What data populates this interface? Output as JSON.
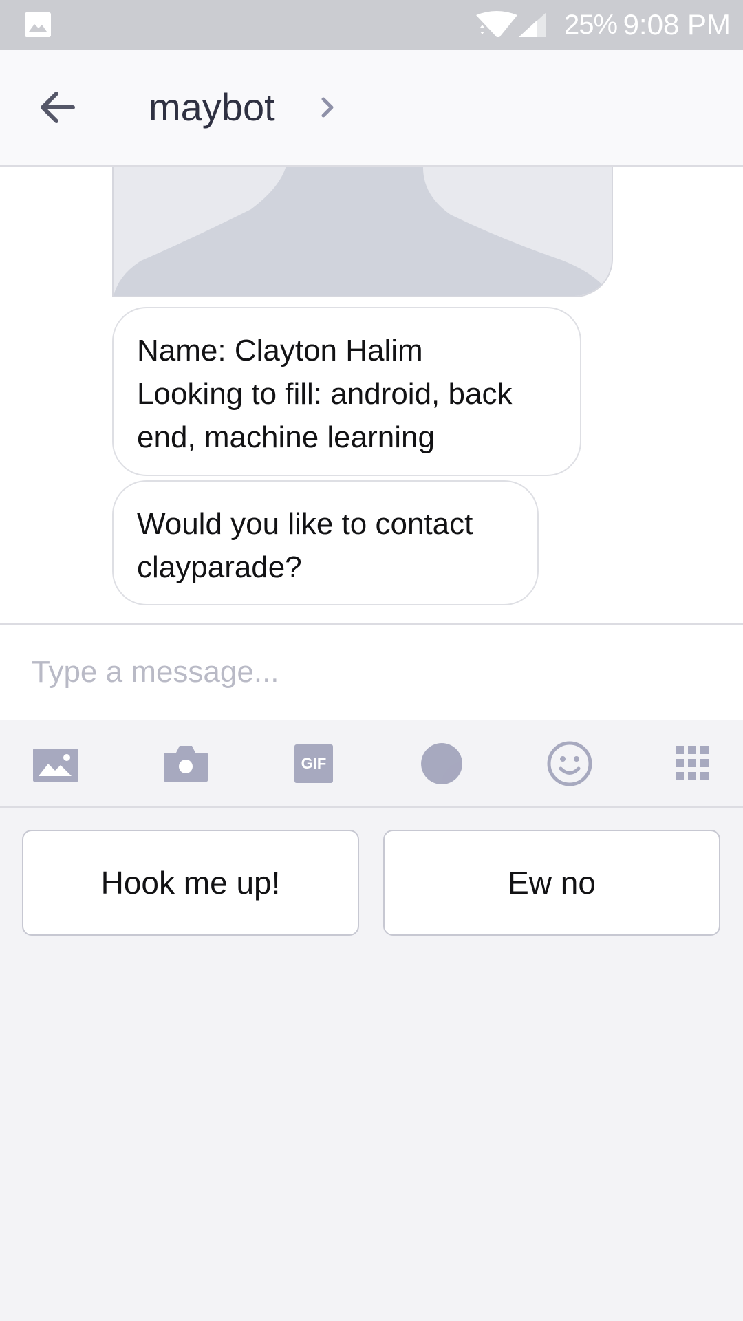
{
  "status_bar": {
    "battery": "25%",
    "time": "9:08 PM"
  },
  "header": {
    "title": "maybot"
  },
  "messages": {
    "profile": {
      "lines": [
        "Name: Clayton Halim",
        "Looking to fill: android, back",
        "end, machine learning"
      ]
    },
    "question": {
      "lines": [
        "Would you like to contact",
        "clayparade?"
      ]
    }
  },
  "composer": {
    "placeholder": "Type a message...",
    "value": ""
  },
  "toolbar": {
    "gif_label": "GIF",
    "icons": [
      "photo-icon",
      "camera-icon",
      "gif-icon",
      "sticker-icon",
      "emoji-icon",
      "apps-grid-icon"
    ]
  },
  "quick_replies": [
    {
      "label": "Hook me up!"
    },
    {
      "label": "Ew no"
    }
  ],
  "colors": {
    "status_bar": "#cbccd1",
    "icon_gray": "#a7a9bf",
    "title_text": "#2f3142",
    "placeholder": "#b9bac6"
  }
}
